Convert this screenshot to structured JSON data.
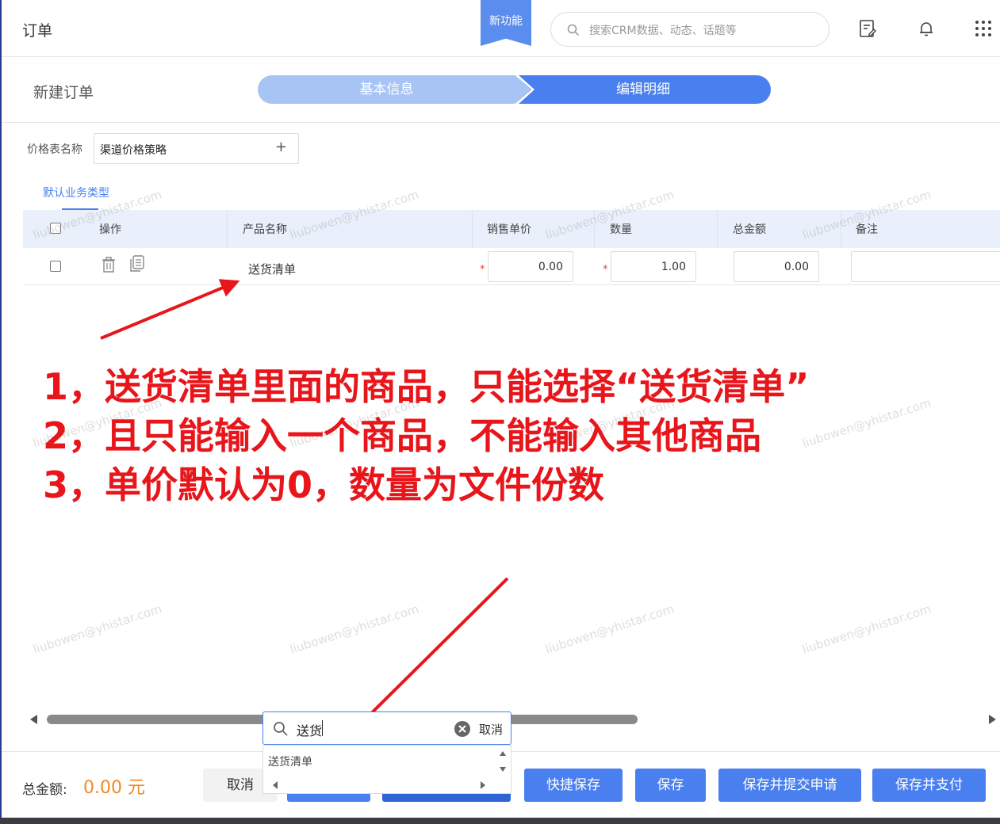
{
  "header": {
    "title": "订单",
    "new_feature_badge": "新功能",
    "search_placeholder": "搜索CRM数据、动态、话题等",
    "icons": [
      "edit-note-icon",
      "bell-icon",
      "apps-grid-icon"
    ]
  },
  "order": {
    "title": "新建订单",
    "steps": [
      {
        "label": "基本信息",
        "state": "done"
      },
      {
        "label": "编辑明细",
        "state": "active"
      }
    ]
  },
  "price_list": {
    "label": "价格表名称",
    "value": "渠道价格策略",
    "add_symbol": "+"
  },
  "business_type_tab": "默认业务类型",
  "table": {
    "columns": [
      "操作",
      "产品名称",
      "销售单价",
      "数量",
      "总金额",
      "备注"
    ],
    "rows": [
      {
        "product_name": "送货清单",
        "unit_price": "0.00",
        "quantity": "1.00",
        "total": "0.00",
        "remark": "",
        "required_mark": "*"
      }
    ]
  },
  "annotations": [
    "1，送货清单里面的商品，只能选择“送货清单”",
    "2，且只能输入一个商品，不能输入其他商品",
    "3，单价默认为0，数量为文件份数"
  ],
  "watermark": "liubowen@yhistar.com",
  "product_search": {
    "value": "送货",
    "cancel_label": "取消",
    "results": [
      "送货清单"
    ]
  },
  "footer": {
    "total_label": "总金额:",
    "total_value": "0.00 元",
    "cancel_label": "取消",
    "quick_save_label": "快捷保存",
    "save_label": "保存",
    "save_submit_label": "保存并提交申请",
    "save_pay_label": "保存并支付"
  },
  "colors": {
    "primary": "#4a7ff0",
    "step_done": "#a8c4f5",
    "annotation_red": "#e8151b",
    "total_orange": "#f08a24"
  }
}
